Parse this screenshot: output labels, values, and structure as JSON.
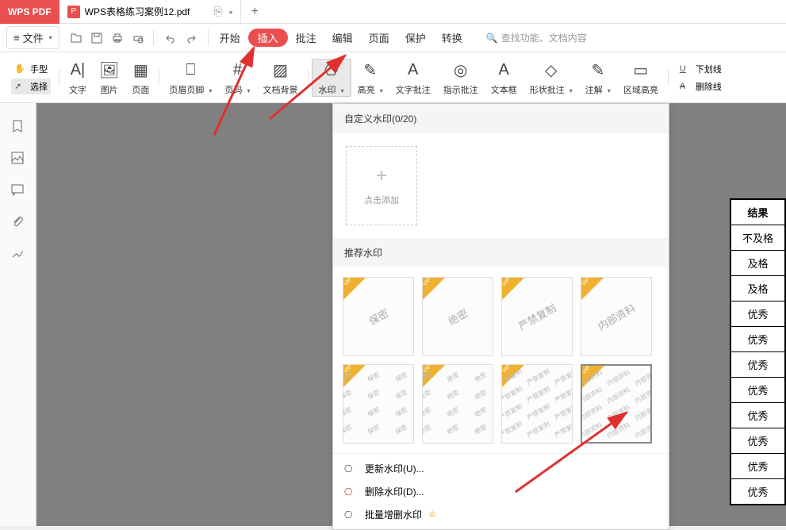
{
  "app": {
    "name": "WPS PDF"
  },
  "tab": {
    "filename": "WPS表格练习案例12.pdf"
  },
  "menubar": {
    "file": "文件",
    "tabs": [
      "开始",
      "插入",
      "批注",
      "编辑",
      "页面",
      "保护",
      "转换"
    ],
    "search_placeholder": "查找功能、文档内容"
  },
  "ribbon_left": {
    "hand": "手型",
    "select": "选择"
  },
  "ribbon": [
    {
      "label": "文字",
      "arrow": false
    },
    {
      "label": "图片",
      "arrow": false
    },
    {
      "label": "页面",
      "arrow": false
    },
    {
      "label": "页眉页脚",
      "arrow": true
    },
    {
      "label": "页码",
      "arrow": true
    },
    {
      "label": "文档背景",
      "arrow": false
    },
    {
      "label": "水印",
      "arrow": true,
      "active": true
    },
    {
      "label": "高亮",
      "arrow": true
    },
    {
      "label": "文字批注",
      "arrow": false
    },
    {
      "label": "指示批注",
      "arrow": false
    },
    {
      "label": "文本框",
      "arrow": false
    },
    {
      "label": "形状批注",
      "arrow": true
    },
    {
      "label": "注解",
      "arrow": true
    },
    {
      "label": "区域高亮",
      "arrow": false
    }
  ],
  "ribbon_right": {
    "underline": "下划线",
    "strikethrough": "删除线"
  },
  "watermark_panel": {
    "custom_title": "自定义水印(0/20)",
    "add_label": "点击添加",
    "recommend_title": "推荐水印",
    "presets_row1": [
      "保密",
      "绝密",
      "严禁复制",
      "内部资料"
    ],
    "presets_row2": [
      "保密",
      "绝密",
      "严禁复制",
      "内部资料"
    ],
    "actions": {
      "update": "更新水印(U)...",
      "delete": "删除水印(D)...",
      "batch": "批量增删水印"
    }
  },
  "table": {
    "header": "结果",
    "rows": [
      "不及格",
      "及格",
      "及格",
      "优秀",
      "优秀",
      "优秀",
      "优秀",
      "优秀",
      "优秀",
      "优秀",
      "优秀"
    ]
  }
}
